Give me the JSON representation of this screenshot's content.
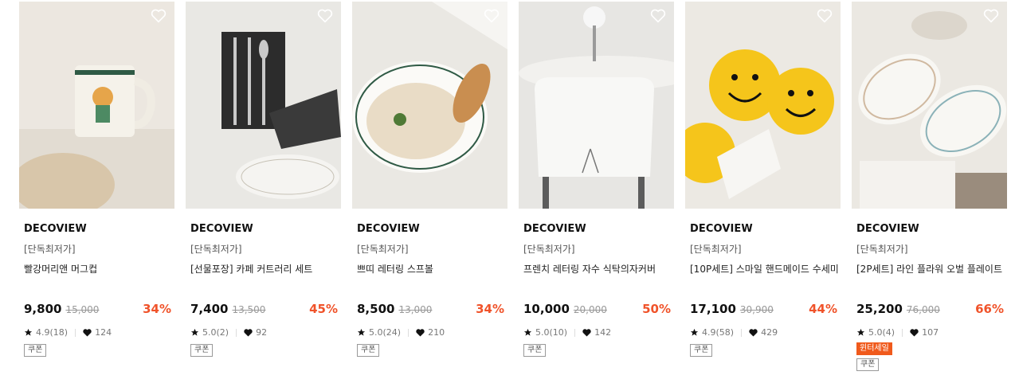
{
  "colors": {
    "discount": "#f0532a",
    "winter_badge": "#f05a1c"
  },
  "products": [
    {
      "brand": "DECOVIEW",
      "tag": "[단독최저가]",
      "name": "빨강머리앤 머그컵",
      "price": "9,800",
      "original_price": "15,000",
      "discount": "34%",
      "rating": "4.9(18)",
      "likes": "124",
      "badges": [
        "쿠폰"
      ]
    },
    {
      "brand": "DECOVIEW",
      "tag": "[단독최저가]",
      "name": "[선물포장] 카페 커트러리 세트",
      "price": "7,400",
      "original_price": "13,500",
      "discount": "45%",
      "rating": "5.0(2)",
      "likes": "92",
      "badges": [
        "쿠폰"
      ]
    },
    {
      "brand": "DECOVIEW",
      "tag": "[단독최저가]",
      "name": "쁘띠 레터링 스프볼",
      "price": "8,500",
      "original_price": "13,000",
      "discount": "34%",
      "rating": "5.0(24)",
      "likes": "210",
      "badges": [
        "쿠폰"
      ]
    },
    {
      "brand": "DECOVIEW",
      "tag": "[단독최저가]",
      "name": "프렌치 레터링 자수 식탁의자커버",
      "price": "10,000",
      "original_price": "20,000",
      "discount": "50%",
      "rating": "5.0(10)",
      "likes": "142",
      "badges": [
        "쿠폰"
      ]
    },
    {
      "brand": "DECOVIEW",
      "tag": "[단독최저가]",
      "name": "[10P세트] 스마일 핸드메이드 수세미",
      "price": "17,100",
      "original_price": "30,900",
      "discount": "44%",
      "rating": "4.9(58)",
      "likes": "429",
      "badges": [
        "쿠폰"
      ]
    },
    {
      "brand": "DECOVIEW",
      "tag": "[단독최저가]",
      "name": "[2P세트] 라인 플라워 오벌 플레이트",
      "price": "25,200",
      "original_price": "76,000",
      "discount": "66%",
      "rating": "5.0(4)",
      "likes": "107",
      "winter_badge": "윈터세일",
      "badges": [
        "쿠폰"
      ]
    }
  ],
  "icons": {
    "wishlist": "heart-outline-icon",
    "rating": "star-icon",
    "likes": "heart-filled-icon"
  }
}
